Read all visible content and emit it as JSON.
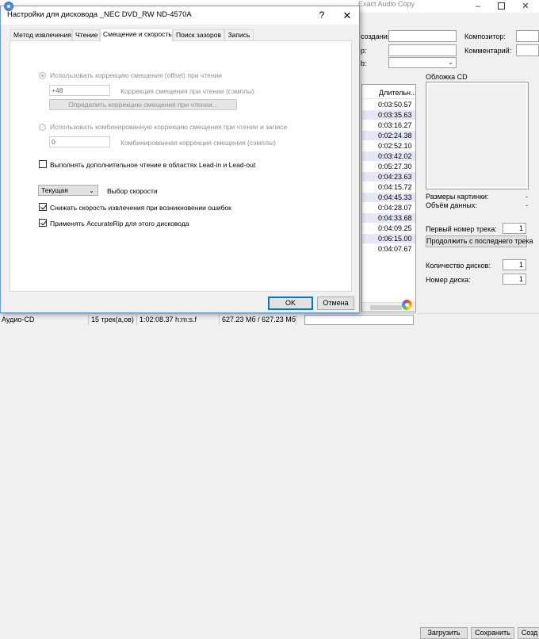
{
  "background_window": {
    "title": "Exact Audio Copy",
    "form": {
      "creation_label": "создания:",
      "composer_label": "Композитор:",
      "comment_label": "Комментарий:",
      "row2_label": "р:",
      "row3_label": "b:"
    },
    "track_list": {
      "header": "Длительн...",
      "durations": [
        "0:03:50.57",
        "0:03:35.63",
        "0:03:16.27",
        "0:02:24.38",
        "0:02:52.10",
        "0:03:42.02",
        "0:05:27.30",
        "0:04:23.63",
        "0:04:15.72",
        "0:04:45.33",
        "0:04:28.07",
        "0:04:33.68",
        "0:04:09.25",
        "0:06:15.00",
        "0:04:07.67"
      ]
    },
    "cover": {
      "title": "Обложка CD",
      "image_sizes_label": "Размеры картинки:",
      "image_sizes_value": "-",
      "data_size_label": "Объём данных:",
      "data_size_value": "-"
    },
    "first_track_label": "Первый номер трека:",
    "first_track_value": "1",
    "continue_button": "Продолжить с последнего трека",
    "disc_count_label": "Количество дисков:",
    "disc_count_value": "1",
    "disc_number_label": "Номер диска:",
    "disc_number_value": "1",
    "buttons": {
      "load": "Загрузить",
      "save": "Сохранить",
      "create": "Созд"
    }
  },
  "status_bar": {
    "format": "Аудио-CD",
    "tracks": "15 трек(а,ов)",
    "duration": "1:02:08.37 h:m:s.f",
    "size": "627.23 Мб / 627.23 Мб"
  },
  "dialog": {
    "title": "Настройки для дисковода _NEC    DVD_RW ND-4570A",
    "help": "?",
    "close": "✕",
    "tabs": [
      {
        "label": "Метод извлечения"
      },
      {
        "label": "Чтение"
      },
      {
        "label": "Смещение и скорость"
      },
      {
        "label": "Поиск зазоров"
      },
      {
        "label": "Запись"
      }
    ],
    "active_tab": "Смещение и скорость",
    "offset": {
      "use_offset_label": "Использовать коррекцию смещения (offset) при чтении",
      "read_offset_value": "+48",
      "read_offset_label": "Коррекция смещения при чтении (сэмплы)",
      "detect_button": "Определить коррекцию смещения при чтении...",
      "combined_label": "Использовать комбинированную коррекцию смещения при чтении и записи",
      "combined_value": "0",
      "combined_value_label": "Комбинированная коррекция смещения (сэмплы)"
    },
    "lead_in_label": "Выполнять дополнительное чтение в областях Lead-in и Lead-out",
    "speed": {
      "selected": "Текущая",
      "label": "Выбор скорости"
    },
    "reduce_speed_label": "Снижать скорость извлечения при возникновении ошибок",
    "accuraterip_label": "Применять AccurateRip для этого дисковода",
    "ok": "OK",
    "cancel": "Отмена"
  }
}
